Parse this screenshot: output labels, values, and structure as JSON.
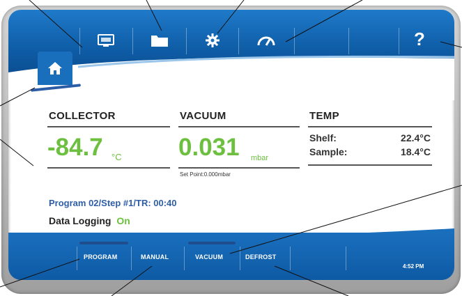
{
  "header": {
    "icons": [
      "home-icon",
      "display-icon",
      "folder-icon",
      "gear-icon",
      "gauge-icon",
      "help-icon"
    ],
    "help_label": "?"
  },
  "collector": {
    "label": "COLLECTOR",
    "value": "-84.7",
    "unit": "°C"
  },
  "vacuum": {
    "label": "VACUUM",
    "value": "0.031",
    "unit": "mbar",
    "set_point": "Set Point:0.000mbar"
  },
  "temp": {
    "label": "TEMP",
    "shelf_label": "Shelf:",
    "shelf_value": "22.4°C",
    "sample_label": "Sample:",
    "sample_value": "18.4°C"
  },
  "program_status": "Program 02/Step #1/TR: 00:40",
  "data_logging": {
    "label": "Data Logging",
    "value": "On"
  },
  "footer": {
    "tabs": [
      "PROGRAM",
      "MANUAL",
      "VACUUM",
      "DEFROST"
    ],
    "time": "4:52 PM"
  },
  "colors": {
    "accent_blue": "#0f5ea8",
    "value_green": "#6cbf3f",
    "status_blue": "#2f5ea8"
  }
}
